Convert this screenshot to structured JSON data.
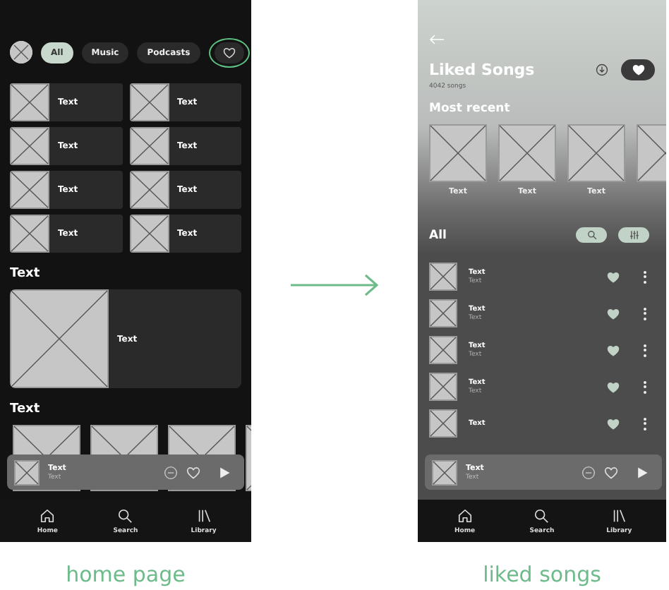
{
  "screens": [
    {
      "kind": "home",
      "caption": "home page",
      "filters": [
        {
          "label": "All",
          "selected": true
        },
        {
          "label": "Music",
          "selected": false
        },
        {
          "label": "Podcasts",
          "selected": false
        }
      ],
      "liked_filter": {
        "annotated": true
      },
      "grid": [
        {
          "title": "Text"
        },
        {
          "title": "Text"
        },
        {
          "title": "Text"
        },
        {
          "title": "Text"
        },
        {
          "title": "Text"
        },
        {
          "title": "Text"
        },
        {
          "title": "Text"
        },
        {
          "title": "Text"
        }
      ],
      "sections": [
        {
          "kind": "featured",
          "heading": "Text",
          "card": {
            "title": "Text"
          }
        },
        {
          "kind": "carousel",
          "heading": "Text"
        }
      ],
      "player": {
        "title": "Text",
        "subtitle": "Text",
        "liked": false
      },
      "nav": [
        {
          "label": "Home",
          "kind": "home"
        },
        {
          "label": "Search",
          "kind": "search"
        },
        {
          "label": "Library",
          "kind": "library"
        }
      ]
    },
    {
      "kind": "liked",
      "caption": "liked songs",
      "title": "Liked Songs",
      "subtitle": "4042 songs",
      "liked": true,
      "recent_heading": "Most recent",
      "recent": [
        {
          "title": "Text"
        },
        {
          "title": "Text"
        },
        {
          "title": "Text"
        }
      ],
      "list_heading": "All",
      "songs": [
        {
          "title": "Text",
          "subtitle": "Text",
          "liked": true
        },
        {
          "title": "Text",
          "subtitle": "Text",
          "liked": true
        },
        {
          "title": "Text",
          "subtitle": "Text",
          "liked": true
        },
        {
          "title": "Text",
          "subtitle": "Text",
          "liked": true
        },
        {
          "title": "Text",
          "liked": true
        }
      ],
      "player": {
        "title": "Text",
        "subtitle": "Text",
        "liked": false
      },
      "nav": [
        {
          "label": "Home",
          "kind": "home"
        },
        {
          "label": "Search",
          "kind": "search"
        },
        {
          "label": "Library",
          "kind": "library"
        }
      ]
    }
  ]
}
